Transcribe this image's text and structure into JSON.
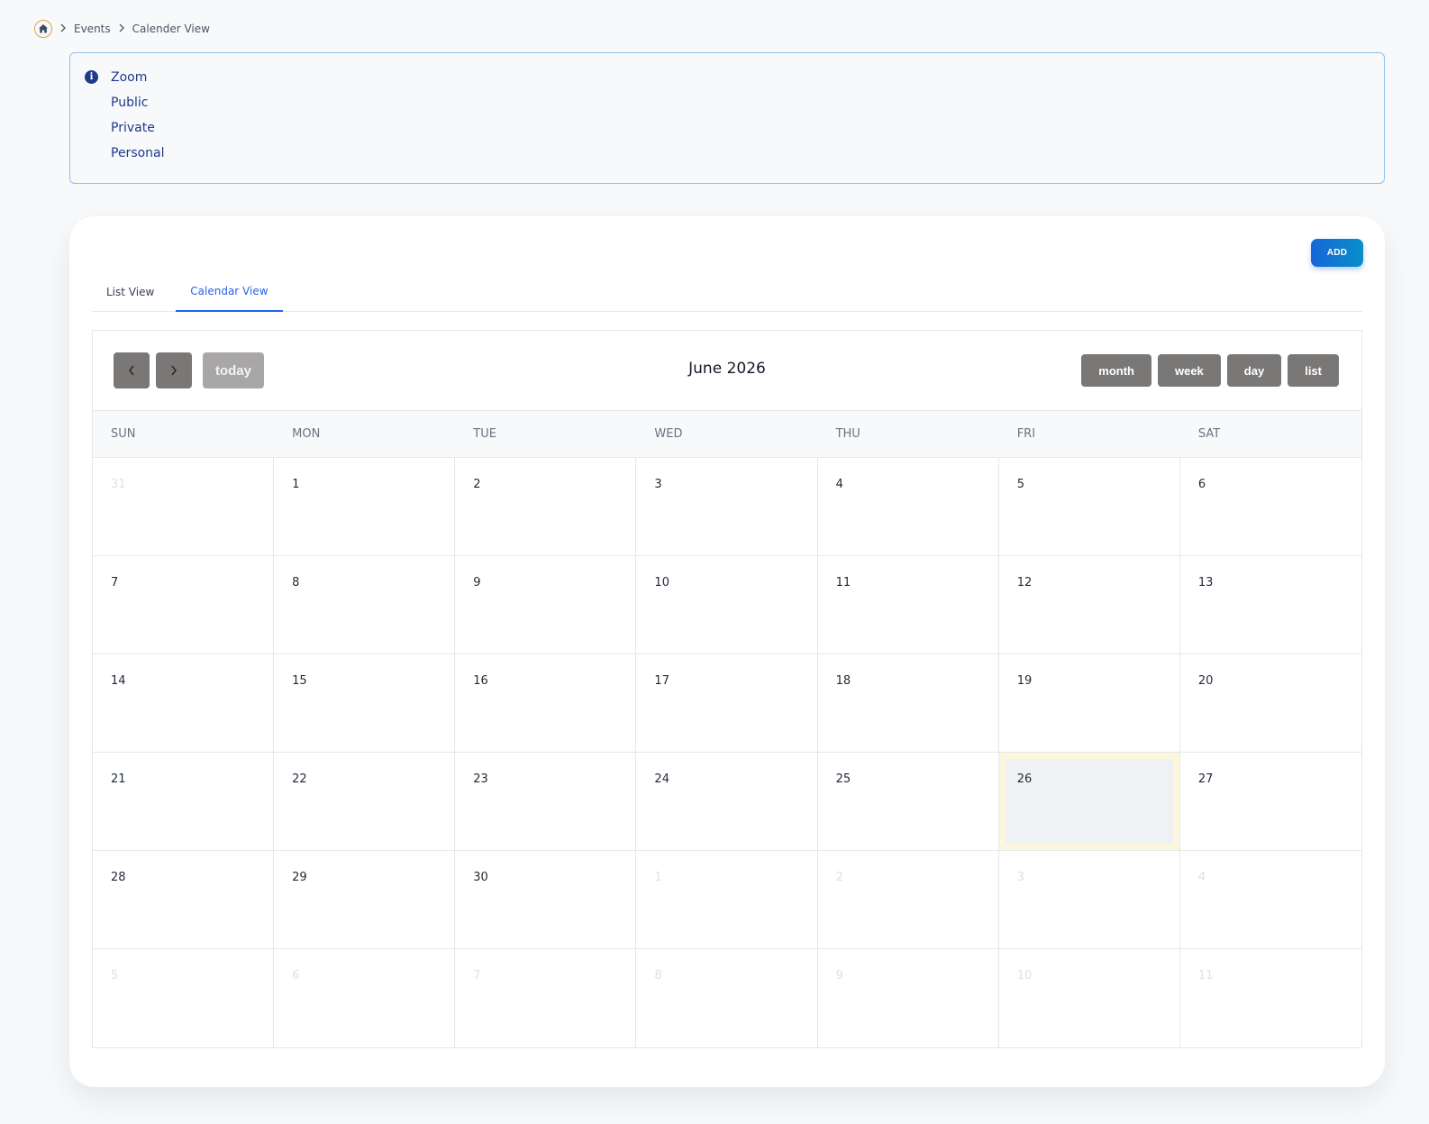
{
  "breadcrumb": {
    "items": [
      "Events",
      "Calender View"
    ]
  },
  "info": {
    "items": [
      "Zoom",
      "Public",
      "Private",
      "Personal"
    ]
  },
  "card": {
    "add_label": "ADD",
    "tabs": [
      "List View",
      "Calendar View"
    ]
  },
  "calendar": {
    "title": "June 2026",
    "today_label": "today",
    "views": [
      "month",
      "week",
      "day",
      "list"
    ],
    "weekdays": [
      "SUN",
      "MON",
      "TUE",
      "WED",
      "THU",
      "FRI",
      "SAT"
    ],
    "days": [
      {
        "n": "31",
        "other": true
      },
      {
        "n": "1"
      },
      {
        "n": "2"
      },
      {
        "n": "3"
      },
      {
        "n": "4"
      },
      {
        "n": "5"
      },
      {
        "n": "6"
      },
      {
        "n": "7"
      },
      {
        "n": "8"
      },
      {
        "n": "9"
      },
      {
        "n": "10"
      },
      {
        "n": "11"
      },
      {
        "n": "12"
      },
      {
        "n": "13"
      },
      {
        "n": "14"
      },
      {
        "n": "15"
      },
      {
        "n": "16"
      },
      {
        "n": "17"
      },
      {
        "n": "18"
      },
      {
        "n": "19"
      },
      {
        "n": "20"
      },
      {
        "n": "21"
      },
      {
        "n": "22"
      },
      {
        "n": "23"
      },
      {
        "n": "24"
      },
      {
        "n": "25"
      },
      {
        "n": "26",
        "today": true
      },
      {
        "n": "27"
      },
      {
        "n": "28"
      },
      {
        "n": "29"
      },
      {
        "n": "30"
      },
      {
        "n": "1",
        "other": true
      },
      {
        "n": "2",
        "other": true
      },
      {
        "n": "3",
        "other": true
      },
      {
        "n": "4",
        "other": true
      },
      {
        "n": "5",
        "other": true
      },
      {
        "n": "6",
        "other": true
      },
      {
        "n": "7",
        "other": true
      },
      {
        "n": "8",
        "other": true
      },
      {
        "n": "9",
        "other": true
      },
      {
        "n": "10",
        "other": true
      },
      {
        "n": "11",
        "other": true
      }
    ]
  },
  "colors": {
    "accent": "#2563eb",
    "info_text": "#1e3a8a",
    "button_gray": "#7a7777",
    "today_highlight": "#fdf6dc"
  }
}
